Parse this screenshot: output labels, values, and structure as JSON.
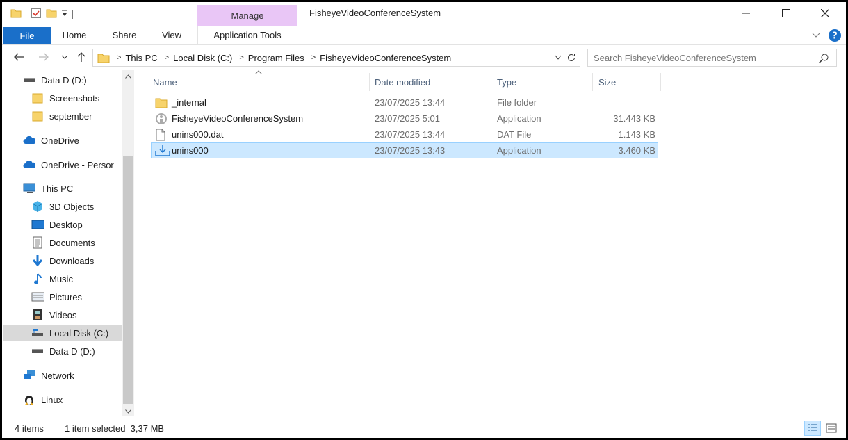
{
  "window": {
    "title": "FisheyeVideoConferenceSystem",
    "context_tab": "Manage",
    "controls": {
      "minimize": "—",
      "maximize": "☐",
      "close": "✕"
    }
  },
  "ribbon": {
    "tabs": [
      "File",
      "Home",
      "Share",
      "View"
    ],
    "context_tab": "Application Tools"
  },
  "address": {
    "crumbs": [
      "This PC",
      "Local Disk (C:)",
      "Program Files",
      "FisheyeVideoConferenceSystem"
    ],
    "search_placeholder": "Search FisheyeVideoConferenceSystem"
  },
  "nav": {
    "items": [
      {
        "label": "Data D (D:)",
        "icon": "drive-icon"
      },
      {
        "label": "Screenshots",
        "icon": "folder-icon"
      },
      {
        "label": "september",
        "icon": "folder-icon"
      },
      {
        "label": "OneDrive",
        "icon": "cloud-icon"
      },
      {
        "label": "OneDrive - Persor",
        "icon": "cloud-icon"
      },
      {
        "label": "This PC",
        "icon": "pc-icon"
      },
      {
        "label": "3D Objects",
        "icon": "cube-icon"
      },
      {
        "label": "Desktop",
        "icon": "desktop-icon"
      },
      {
        "label": "Documents",
        "icon": "documents-icon"
      },
      {
        "label": "Downloads",
        "icon": "download-icon"
      },
      {
        "label": "Music",
        "icon": "music-icon"
      },
      {
        "label": "Pictures",
        "icon": "pictures-icon"
      },
      {
        "label": "Videos",
        "icon": "videos-icon"
      },
      {
        "label": "Local Disk (C:)",
        "icon": "system-drive-icon"
      },
      {
        "label": "Data D (D:)",
        "icon": "drive-icon"
      },
      {
        "label": "Network",
        "icon": "network-icon"
      },
      {
        "label": "Linux",
        "icon": "linux-icon"
      }
    ],
    "selected": "Local Disk (C:)"
  },
  "files": {
    "columns": [
      "Name",
      "Date modified",
      "Type",
      "Size"
    ],
    "rows": [
      {
        "name": "_internal",
        "date": "23/07/2025 13:44",
        "type": "File folder",
        "size": "",
        "icon": "folder-icon"
      },
      {
        "name": "FisheyeVideoConferenceSystem",
        "date": "23/07/2025 5:01",
        "type": "Application",
        "size": "31.443 KB",
        "icon": "app-icon"
      },
      {
        "name": "unins000.dat",
        "date": "23/07/2025 13:44",
        "type": "DAT File",
        "size": "1.143 KB",
        "icon": "file-icon"
      },
      {
        "name": "unins000",
        "date": "23/07/2025 13:43",
        "type": "Application",
        "size": "3.460 KB",
        "icon": "installer-icon"
      }
    ],
    "selected": "unins000"
  },
  "status": {
    "items": "4 items",
    "selection": "1 item selected  3,37 MB"
  },
  "colors": {
    "accent": "#1a6fc9",
    "manage_tab": "#e9c6f6",
    "selection": "#cce8ff",
    "selection_border": "#99d1ff",
    "header_text": "#4c607a",
    "folder": "#f7d36b"
  }
}
